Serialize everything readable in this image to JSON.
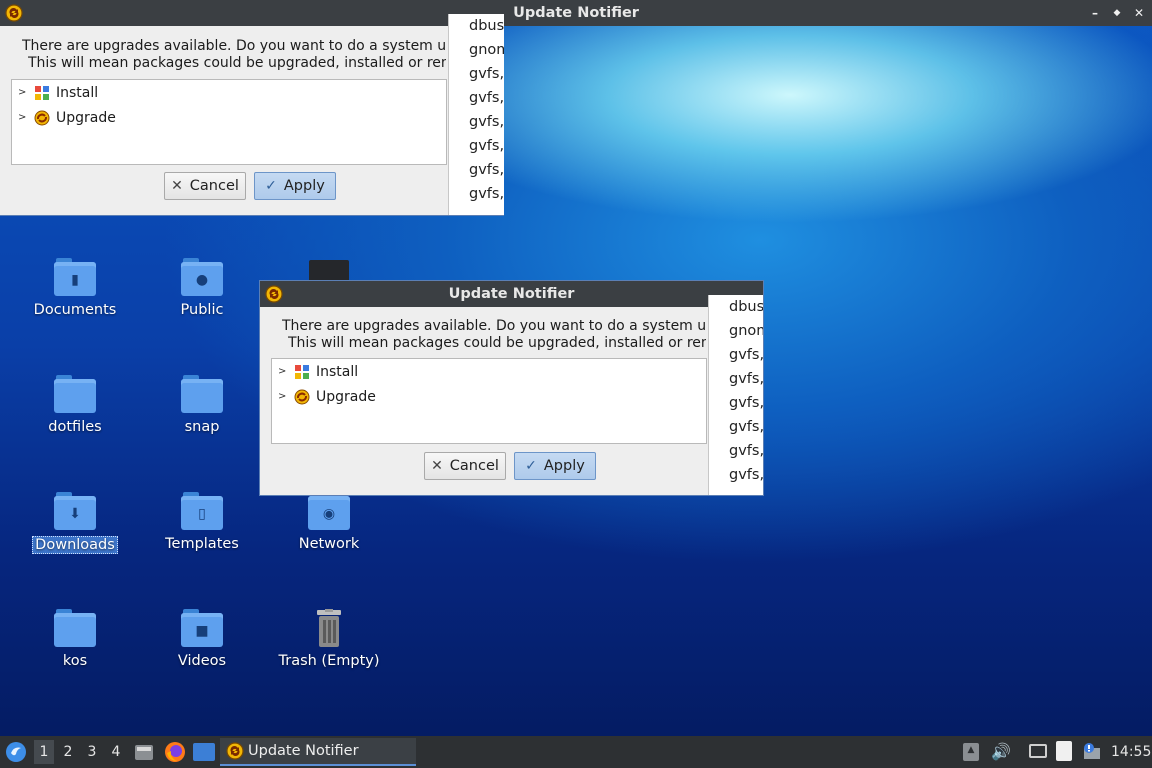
{
  "window": {
    "title": "Update Notifier",
    "message_line1": "There are upgrades available. Do you want to do a system upgrade?",
    "message_line2": "This will mean packages could be upgraded, installed or removed.",
    "tree_items": [
      "Install",
      "Upgrade"
    ],
    "side_list": [
      "dbus,",
      "gnome",
      "gvfs,",
      "gvfs,",
      "gvfs,",
      "gvfs,",
      "gvfs,",
      "gvfs,"
    ],
    "cancel_label": "Cancel",
    "apply_label": "Apply",
    "controls": {
      "minimize": "–",
      "maximize": "◆",
      "close": "✕"
    }
  },
  "desktop_icons": [
    {
      "label": "Documents",
      "icon": "document-folder-icon"
    },
    {
      "label": "Public",
      "icon": "public-folder-icon"
    },
    {
      "label": "dotfiles",
      "icon": "folder-icon"
    },
    {
      "label": "snap",
      "icon": "folder-icon"
    },
    {
      "label": "Downloads",
      "icon": "downloads-folder-icon",
      "selected": true
    },
    {
      "label": "Templates",
      "icon": "templates-folder-icon"
    },
    {
      "label": "Network",
      "icon": "network-folder-icon"
    },
    {
      "label": "kos",
      "icon": "folder-icon"
    },
    {
      "label": "Videos",
      "icon": "videos-folder-icon"
    },
    {
      "label": "Trash (Empty)",
      "icon": "trash-icon"
    }
  ],
  "taskbar": {
    "workspaces": [
      "1",
      "2",
      "3",
      "4"
    ],
    "active_workspace": "1",
    "task_label": "Update Notifier",
    "clock": "14:55"
  },
  "colors": {
    "titlebar": "#3b3f43",
    "apply_button": "#aecaeb",
    "folder": "#5ea0ee",
    "selection": "#3d74c9",
    "taskbar": "#2d3033"
  }
}
